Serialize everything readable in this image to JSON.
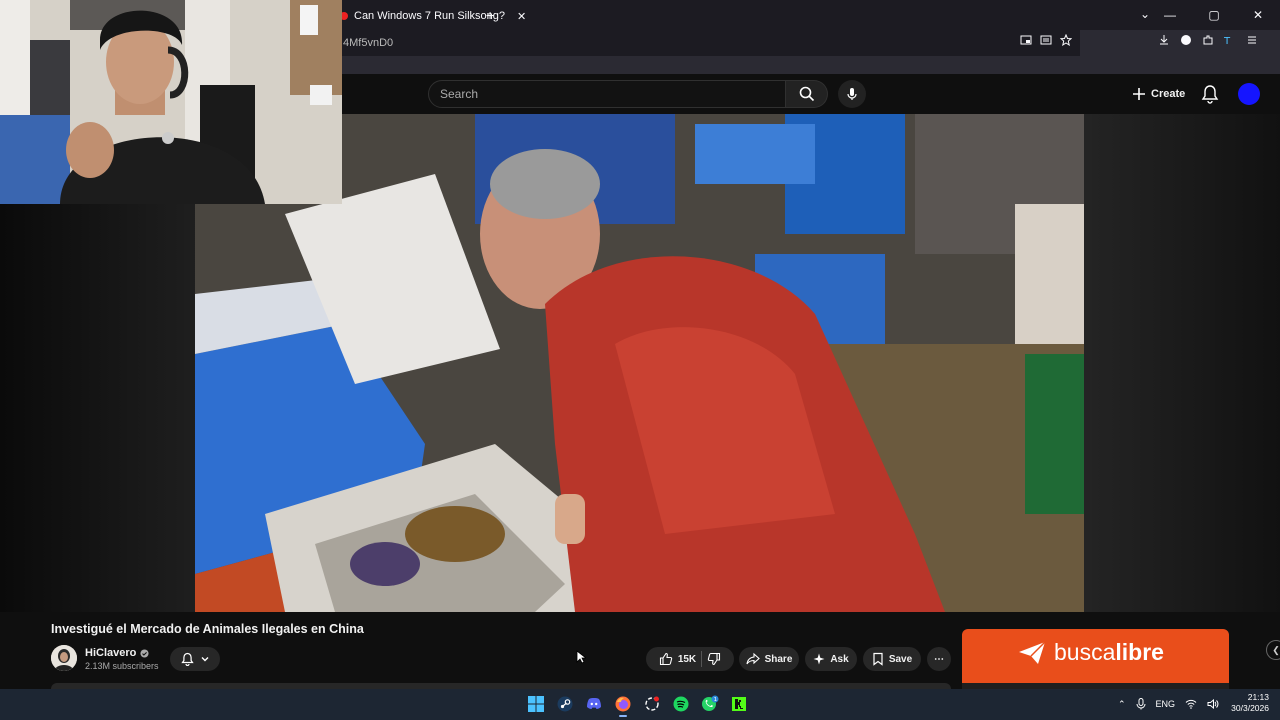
{
  "browser": {
    "tab_title": "Can Windows 7 Run Silksong?",
    "tab_close": "✕",
    "new_tab": "+",
    "url_fragment": "4Mf5vnD0",
    "window_controls": [
      "—",
      "▢",
      "✕"
    ],
    "list_tabs": "⌄"
  },
  "youtube": {
    "search_placeholder": "Search",
    "create_label": "Create",
    "accent": "#ff0000"
  },
  "video": {
    "title": "Investigué el Mercado de Animales Ilegales en China",
    "channel": {
      "name": "HiClavero",
      "verified_icon": "verified-check-icon",
      "subscribers": "2.13M subscribers"
    },
    "actions": {
      "likes": "15K",
      "share": "Share",
      "ask": "Ask",
      "save": "Save",
      "more": "⋯"
    }
  },
  "ad": {
    "brand_regular": "busca",
    "brand_bold": "libre",
    "color": "#e94e1b"
  },
  "taskbar": {
    "apps": [
      "windows-start-icon",
      "steam-icon",
      "discord-icon",
      "firefox-icon",
      "chatgpt-icon",
      "spotify-icon",
      "whatsapp-icon",
      "kick-icon"
    ],
    "language": "ENG",
    "time": "21:13",
    "date": "30/3/2026",
    "whatsapp_badge": "1"
  }
}
